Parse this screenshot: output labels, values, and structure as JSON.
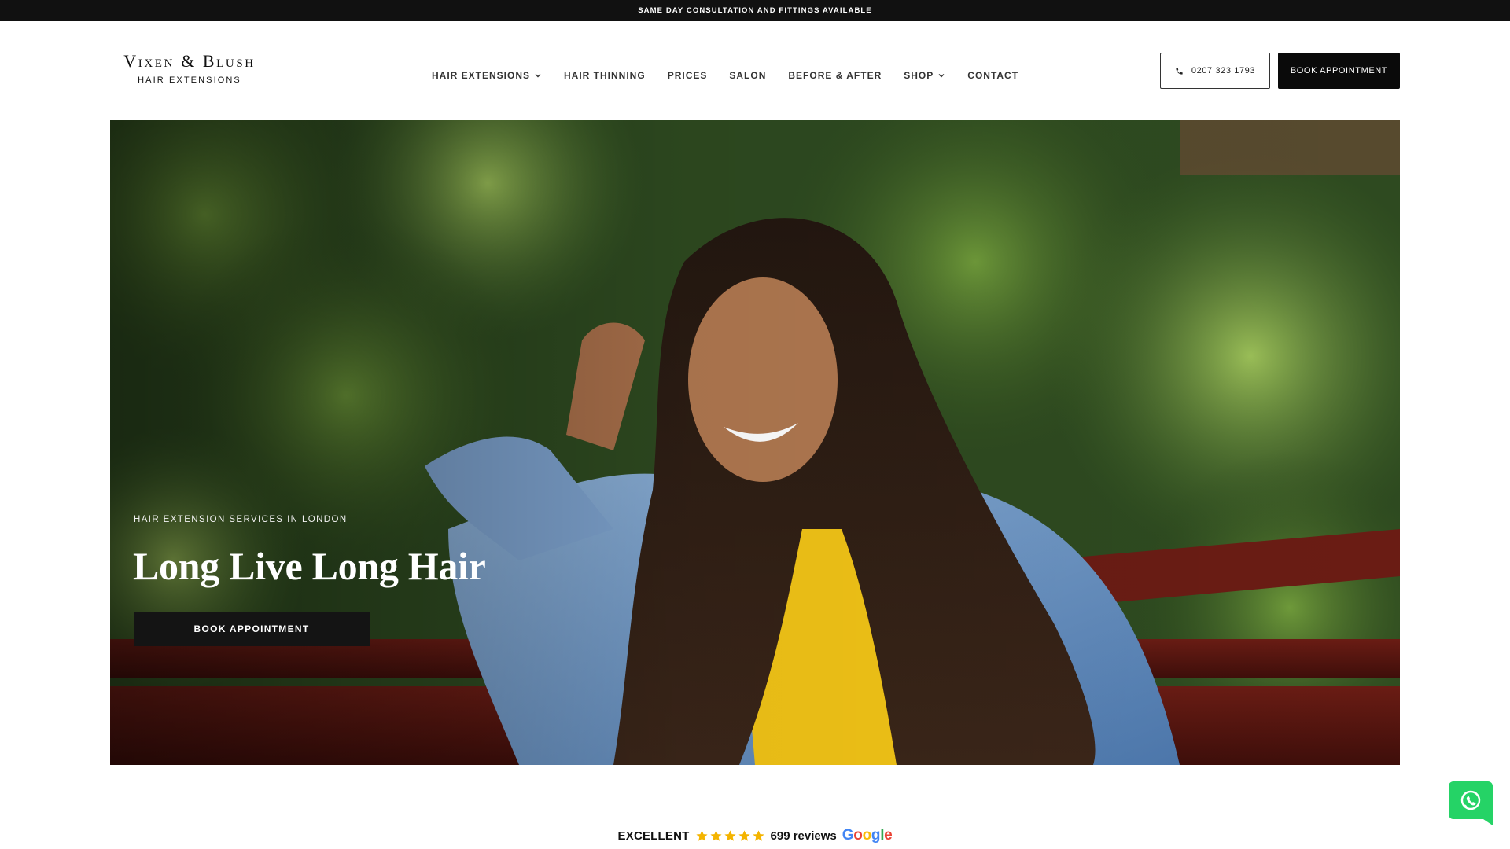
{
  "announcement": {
    "text": "SAME DAY CONSULTATION AND FITTINGS AVAILABLE"
  },
  "logo": {
    "main": "Vixen & Blush",
    "sub": "HAIR EXTENSIONS"
  },
  "nav": {
    "items": [
      {
        "label": "HAIR EXTENSIONS",
        "has_dropdown": true
      },
      {
        "label": "HAIR THINNING",
        "has_dropdown": false
      },
      {
        "label": "PRICES",
        "has_dropdown": false
      },
      {
        "label": "SALON",
        "has_dropdown": false
      },
      {
        "label": "BEFORE & AFTER",
        "has_dropdown": false
      },
      {
        "label": "SHOP",
        "has_dropdown": true
      },
      {
        "label": "CONTACT",
        "has_dropdown": false
      }
    ]
  },
  "header_actions": {
    "phone_label": "0207 323 1793",
    "phone_icon": "phone-icon",
    "book_label": "BOOK APPOINTMENT"
  },
  "hero": {
    "eyebrow": "HAIR EXTENSION SERVICES IN LONDON",
    "title": "Long Live Long Hair",
    "cta_label": "BOOK APPOINTMENT"
  },
  "reviews": {
    "rating_word": "EXCELLENT",
    "stars": 5,
    "count_label": "699 reviews",
    "provider": "Google"
  },
  "chat_widget": {
    "icon": "whatsapp-icon"
  },
  "colors": {
    "dark": "#111111",
    "white": "#ffffff",
    "star": "#f4b400",
    "whatsapp": "#25d366"
  }
}
